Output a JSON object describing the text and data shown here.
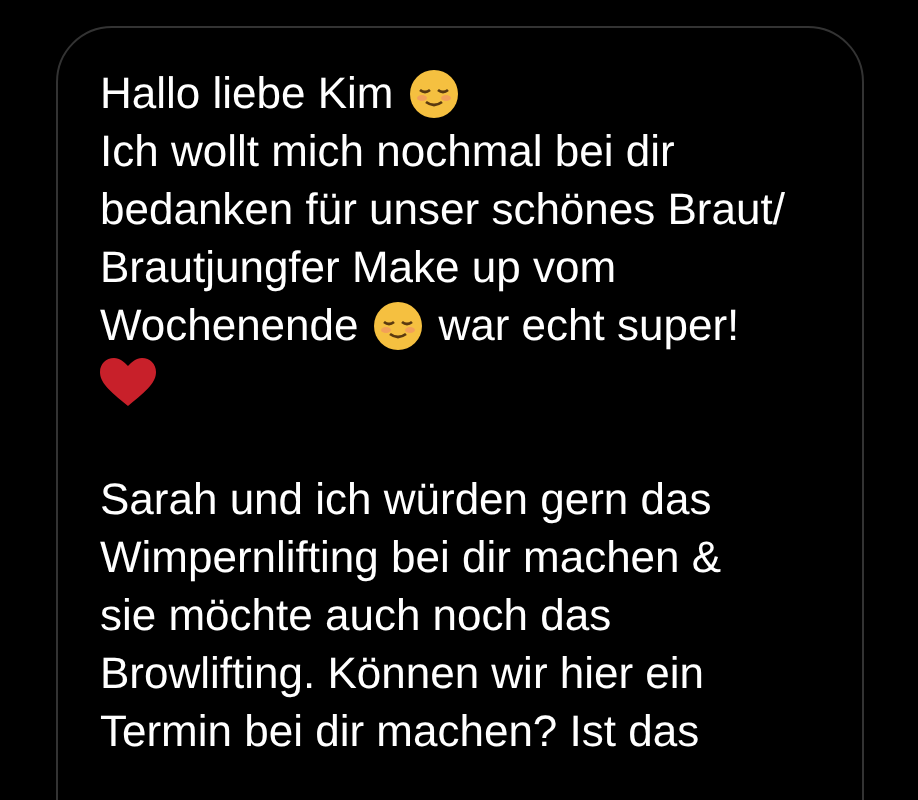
{
  "message": {
    "paragraphs": [
      {
        "lines": [
          [
            {
              "kind": "text",
              "text": "Hallo liebe Kim"
            },
            {
              "kind": "smile"
            }
          ],
          [
            {
              "kind": "text",
              "text": "Ich wollt mich nochmal bei dir"
            }
          ],
          [
            {
              "kind": "text",
              "text": "bedanken für unser schönes Braut/"
            }
          ],
          [
            {
              "kind": "text",
              "text": "Brautjungfer Make up vom"
            }
          ],
          [
            {
              "kind": "text",
              "text": "Wochenende"
            },
            {
              "kind": "smile"
            },
            {
              "kind": "text",
              "text": "war echt super!"
            }
          ],
          [
            {
              "kind": "heart"
            }
          ]
        ]
      },
      {
        "lines": [
          [
            {
              "kind": "text",
              "text": "Sarah und ich würden gern das"
            }
          ],
          [
            {
              "kind": "text",
              "text": "Wimpernlifting bei dir machen &"
            }
          ],
          [
            {
              "kind": "text",
              "text": "sie möchte auch noch das"
            }
          ],
          [
            {
              "kind": "text",
              "text": "Browlifting. Können wir hier ein"
            }
          ],
          [
            {
              "kind": "text",
              "text": "Termin bei dir machen? Ist das"
            }
          ]
        ]
      }
    ]
  }
}
